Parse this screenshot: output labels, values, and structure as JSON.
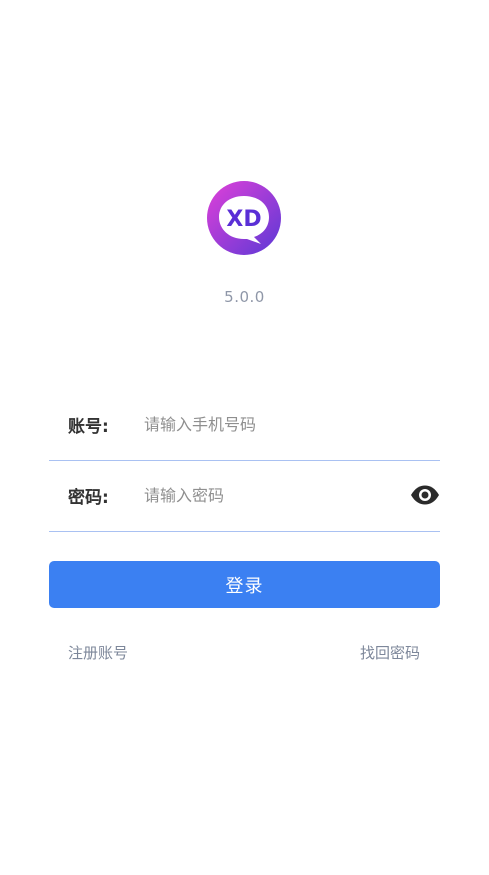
{
  "app": {
    "logo_text": "XD",
    "version": "5.0.0",
    "colors": {
      "accent": "#3b80f2",
      "logo_gradient_start": "#e040d8",
      "logo_gradient_end": "#5b39d6",
      "input_underline": "#a9c1f2"
    }
  },
  "form": {
    "account": {
      "label": "账号:",
      "placeholder": "请输入手机号码",
      "value": ""
    },
    "password": {
      "label": "密码:",
      "placeholder": "请输入密码",
      "value": "",
      "toggle_icon": "eye-icon"
    },
    "login_label": "登录"
  },
  "links": {
    "register": "注册账号",
    "forgot_password": "找回密码"
  }
}
